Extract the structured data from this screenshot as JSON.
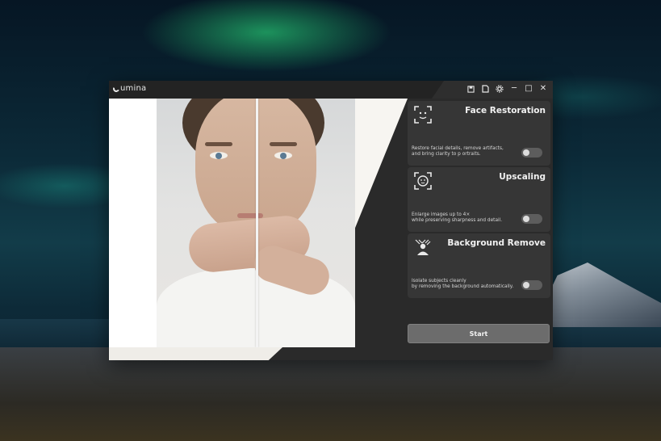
{
  "app": {
    "name": "umina",
    "title_icons": [
      "save-icon",
      "file-icon",
      "settings-icon",
      "minimize-icon",
      "maximize-icon",
      "close-icon"
    ],
    "title_glyphs": {
      "minimize": "─",
      "maximize": "□",
      "close": "✕"
    }
  },
  "features": [
    {
      "title": "Face Restoration",
      "icon": "face-scan-icon",
      "description_line1": "Restore facial details, remove artifacts,",
      "description_line2": "and bring clarity to p  ortraits.",
      "enabled": false
    },
    {
      "title": "Upscaling",
      "icon": "face-frame-icon",
      "description_line1": "Enlarge images up to 4×",
      "description_line2": "while preserving sharpness and detail.",
      "enabled": false
    },
    {
      "title": "Background Remove",
      "icon": "person-cutout-icon",
      "description_line1": "Isolate subjects cleanly",
      "description_line2": "by removing the background automatically.",
      "enabled": false
    }
  ],
  "start_label": "Start",
  "colors": {
    "window_bg": "#2a2a2a",
    "card_bg": "#363636",
    "button_bg": "#6c6c6c",
    "toggle_off": "#5d5d5d"
  }
}
